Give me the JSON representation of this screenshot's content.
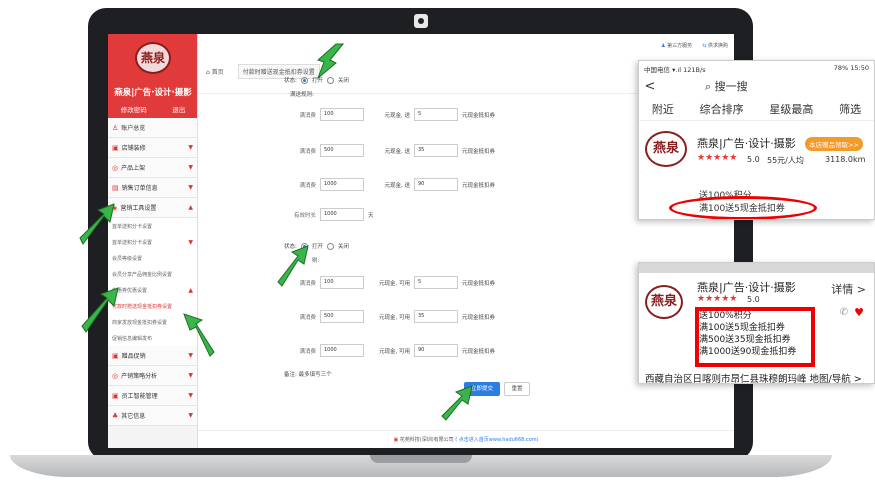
{
  "sidebar": {
    "brand_logo": "燕泉",
    "brand_title": "燕泉|广告·设计·摄影",
    "modify_password": "修改密码",
    "logout": "退出",
    "items": [
      {
        "label": "账户总览"
      },
      {
        "label": "店铺装修"
      },
      {
        "label": "产品上架"
      },
      {
        "label": "销售订单信息"
      },
      {
        "label": "营销工具设置"
      },
      {
        "label": "首单送积分卡设置"
      },
      {
        "label": "首单送积分卡设置"
      },
      {
        "label": "会员等级设置"
      },
      {
        "label": "会员分享产品佣金比例设置"
      },
      {
        "label": "优惠券优惠设置"
      },
      {
        "label": "付款时赠送现金抵扣券设置"
      },
      {
        "label": "商家发放现金抵扣券设置"
      },
      {
        "label": "促销信息编辑发布"
      },
      {
        "label": "赠品促销"
      },
      {
        "label": "产销策略分析"
      },
      {
        "label": "员工智能管理"
      },
      {
        "label": "其它信息"
      }
    ]
  },
  "topbar": {
    "home": "首页",
    "tab": "付款时赠送现金抵扣券设置",
    "third_party": "第三方服务",
    "provider": "供求换购"
  },
  "form": {
    "status_label": "状态:",
    "open": "打开",
    "close": "关闭",
    "gift_rules": "满送规则:",
    "rules1": [
      {
        "prefix": "满消费",
        "amount": "100",
        "middle": "元现金, 送",
        "value": "5",
        "suffix": "元现金抵扣券"
      },
      {
        "prefix": "满消费",
        "amount": "500",
        "middle": "元现金, 送",
        "value": "35",
        "suffix": "元现金抵扣券"
      },
      {
        "prefix": "满消费",
        "amount": "1000",
        "middle": "元现金, 送",
        "value": "90",
        "suffix": "元现金抵扣券"
      }
    ],
    "valid_label": "有效时长",
    "valid_value": "1000",
    "valid_unit": "天",
    "status2_label": "状态:",
    "rules2_label": "则:",
    "rules2": [
      {
        "prefix": "满消费",
        "amount": "100",
        "middle": "元现金, 可用",
        "value": "5",
        "suffix": "元现金抵扣券"
      },
      {
        "prefix": "满消费",
        "amount": "500",
        "middle": "元现金, 可用",
        "value": "35",
        "suffix": "元现金抵扣券"
      },
      {
        "prefix": "满消费",
        "amount": "1000",
        "middle": "元现金, 可用",
        "value": "90",
        "suffix": "元现金抵扣券"
      }
    ],
    "note": "备注: 最多填写三个",
    "submit": "立即提交",
    "reset": "重置"
  },
  "footer": {
    "company": "花苑科技(深圳)有限公司",
    "link": "( 点击进入首页www.hadu668.com)"
  },
  "phone1": {
    "status_left": "中国电信 ▾.ıl 121B/s",
    "status_right": "78% 15:50",
    "back": "<",
    "search": "搜一搜",
    "filters": [
      "附近",
      "综合排序",
      "星级最高",
      "筛选"
    ],
    "shop_logo": "燕泉",
    "shop_name": "燕泉|广告·设计·摄影",
    "badge": "本店赠品领取>>",
    "stars": "★★★★★",
    "rating": "5.0",
    "price": "55元/人均",
    "distance": "3118.0km",
    "promo_points": "送100%积分",
    "promo_coupon": "满100送5现金抵扣券"
  },
  "phone2": {
    "shop_name": "燕泉|广告·设计·摄影",
    "detail": "详情 >",
    "rating": "5.0",
    "promos": [
      "送100%积分",
      "满100送5现金抵扣券",
      "满500送35现金抵扣券",
      "满1000送90现金抵扣券"
    ],
    "address": "西藏自治区日喀则市昂仁县珠穆朗玛峰",
    "map": "地图/导航 >"
  }
}
